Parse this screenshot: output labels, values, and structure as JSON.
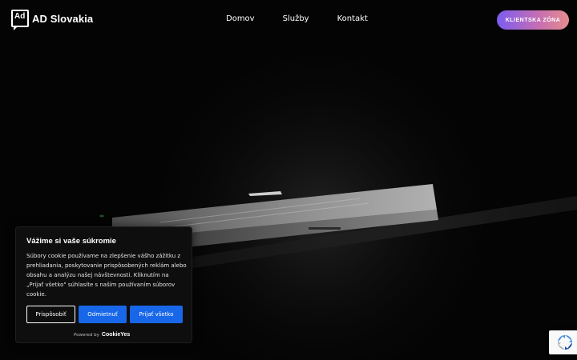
{
  "header": {
    "logo_mark": "Ad",
    "logo_text": "AD Slovakia",
    "nav": [
      {
        "label": "Domov"
      },
      {
        "label": "Služby"
      },
      {
        "label": "Kontakt"
      }
    ],
    "client_button": "KLIENTSKA ZÓNA"
  },
  "cookie_banner": {
    "title": "Vážime si vaše súkromie",
    "text": "Súbory cookie používame na zlepšenie vášho zážitku z prehliadania, poskytovanie prispôsobených reklám alebo obsahu a analýzu našej návštevnosti. Kliknutím na „Prijať všetko\" súhlasíte s naším používaním súborov cookie.",
    "buttons": {
      "customize": "Prispôsobiť",
      "reject": "Odmietnuť",
      "accept": "Prijať všetko"
    },
    "powered_by": "Powered by",
    "powered_brand": "CookieYes"
  },
  "colors": {
    "accent_blue": "#1867e8",
    "client_gradient_start": "#7b5cf0",
    "client_gradient_end": "#e58d8e"
  },
  "icons": {
    "logo": "ad-logo-icon",
    "recaptcha": "recaptcha-icon"
  }
}
